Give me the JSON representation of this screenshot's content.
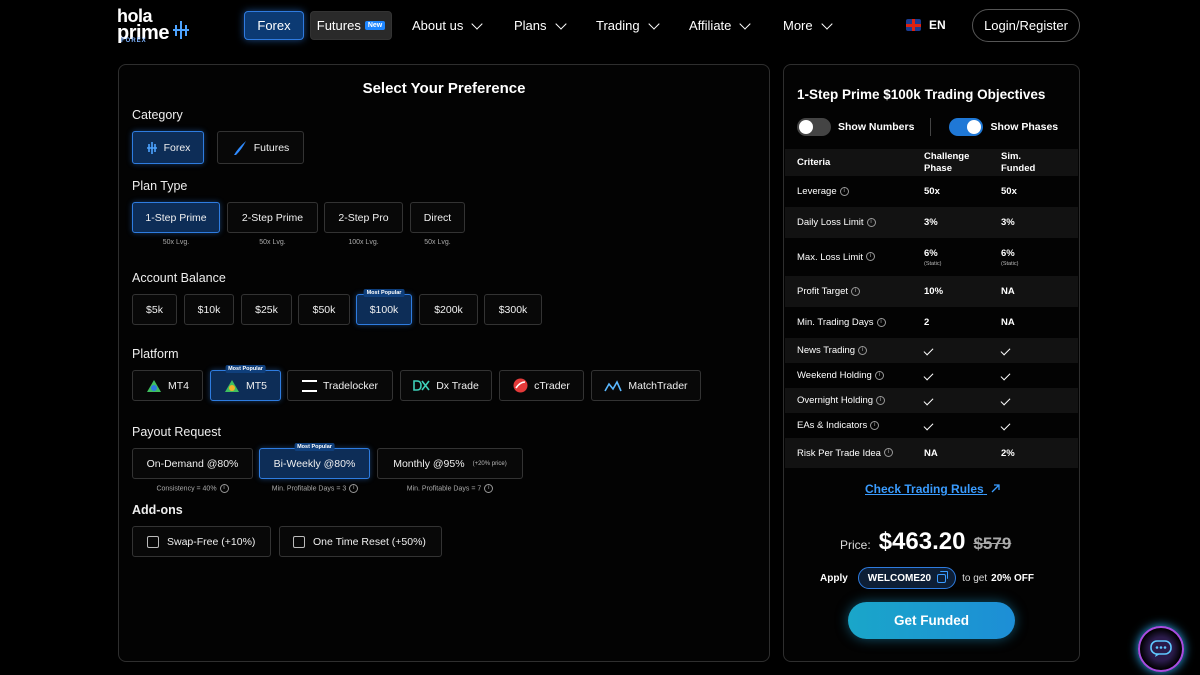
{
  "logo": {
    "line1": "hola",
    "line2": "prime",
    "line3": "FOREX"
  },
  "nav": {
    "forex": "Forex",
    "futures": "Futures",
    "futures_badge": "New",
    "items": [
      "About us",
      "Plans",
      "Trading",
      "Affiliate",
      "More"
    ],
    "lang": "EN",
    "login": "Login/Register"
  },
  "left": {
    "title": "Select Your Preference",
    "category_label": "Category",
    "categories": [
      "Forex",
      "Futures"
    ],
    "plan_type_label": "Plan Type",
    "plans": [
      {
        "name": "1-Step Prime",
        "sub": "50x Lvg."
      },
      {
        "name": "2-Step Prime",
        "sub": "50x Lvg."
      },
      {
        "name": "2-Step Pro",
        "sub": "100x Lvg."
      },
      {
        "name": "Direct",
        "sub": "50x Lvg."
      }
    ],
    "balance_label": "Account Balance",
    "balances": [
      "$5k",
      "$10k",
      "$25k",
      "$50k",
      "$100k",
      "$200k",
      "$300k"
    ],
    "most_popular": "Most Popular",
    "platform_label": "Platform",
    "platforms": [
      "MT4",
      "MT5",
      "Tradelocker",
      "Dx Trade",
      "cTrader",
      "MatchTrader"
    ],
    "payout_label": "Payout Request",
    "payouts": [
      {
        "name": "On-Demand @80%",
        "sub": "Consistency = 40%"
      },
      {
        "name": "Bi-Weekly @80%",
        "sub": "Min. Profitable Days = 3"
      },
      {
        "name": "Monthly @95%",
        "extra": "(+20% price)",
        "sub": "Min. Profitable Days = 7"
      }
    ],
    "addons_label": "Add-ons",
    "addons": [
      "Swap-Free (+10%)",
      "One Time Reset (+50%)"
    ]
  },
  "right": {
    "title": "1-Step Prime $100k Trading Objectives",
    "toggle_numbers": "Show Numbers",
    "toggle_phases": "Show Phases",
    "head": {
      "criteria": "Criteria",
      "col1": "Challenge Phase",
      "col2": "Sim. Funded"
    },
    "rows": [
      {
        "label": "Leverage",
        "a": "50x",
        "b": "50x"
      },
      {
        "label": "Daily Loss Limit",
        "a": "3%",
        "b": "3%"
      },
      {
        "label": "Max. Loss Limit",
        "a": "6%",
        "a_sub": "(Static)",
        "b": "6%",
        "b_sub": "(Static)"
      },
      {
        "label": "Profit Target",
        "a": "10%",
        "b": "NA"
      },
      {
        "label": "Min. Trading Days",
        "a": "2",
        "b": "NA"
      },
      {
        "label": "News Trading"
      },
      {
        "label": "Weekend Holding"
      },
      {
        "label": "Overnight Holding"
      },
      {
        "label": "EAs & Indicators"
      },
      {
        "label": "Risk Per Trade Idea",
        "a": "NA",
        "b": "2%"
      }
    ],
    "rules_link": "Check Trading Rules",
    "price_label": "Price:",
    "price": "$463.20",
    "price_old": "$579",
    "apply": "Apply",
    "code": "WELCOME20",
    "to_get": "to get",
    "discount": "20% OFF",
    "cta": "Get Funded"
  },
  "colors": {
    "accent": "#2e7ce0",
    "cta": "#1aa6c9",
    "link": "#3a9cff"
  }
}
